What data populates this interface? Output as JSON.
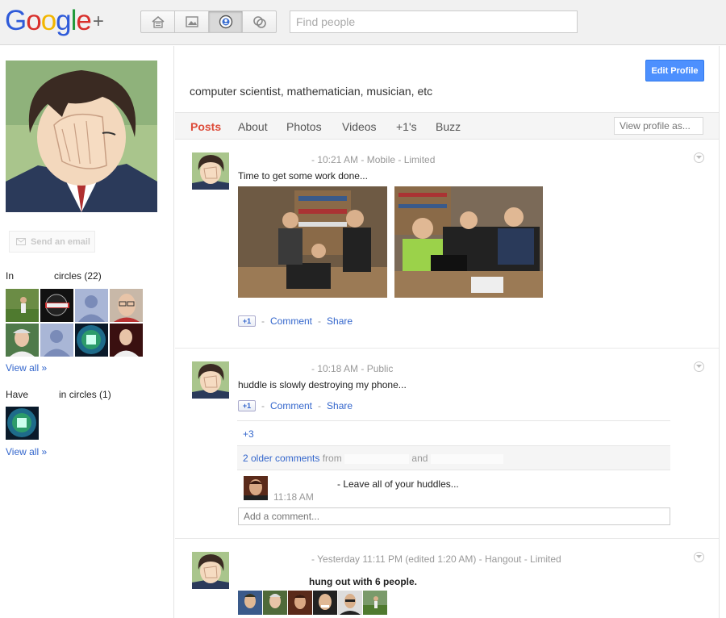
{
  "header": {
    "logo_parts": [
      "G",
      "o",
      "o",
      "g",
      "l",
      "e"
    ],
    "logo_plus": "+",
    "search_placeholder": "Find people",
    "nav_icons": [
      "home-icon",
      "photos-icon",
      "profile-icon",
      "circles-icon"
    ]
  },
  "profile": {
    "email_label": "Send an email",
    "in_circles_label": "In",
    "in_circles_count": "circles (22)",
    "have_label": "Have",
    "have_count": "in circles (1)",
    "view_all_1": "View all »",
    "view_all_2": "View all »",
    "edit_label": "Edit Profile",
    "tagline": "computer scientist, mathematician, musician, etc"
  },
  "tabs": [
    "Posts",
    "About",
    "Photos",
    "Videos",
    "+1's",
    "Buzz"
  ],
  "view_as_placeholder": "View profile as...",
  "posts": [
    {
      "meta": "-  10:21 AM  -  Mobile  -  Limited",
      "text": "Time to get some work done...",
      "comment": "Comment",
      "share": "Share",
      "plusone": "+1"
    },
    {
      "meta": "-  10:18 AM  -  Public",
      "text": "huddle is slowly destroying my phone...",
      "comment": "Comment",
      "share": "Share",
      "plusone": "+1",
      "plus_count": "+3",
      "older_comments": "2 older comments",
      "from_label": "from",
      "and_label": "and",
      "comment_text": "- Leave all of your huddles...",
      "comment_time": "11:18 AM",
      "add_comment_placeholder": "Add a comment..."
    },
    {
      "meta": "-  Yesterday 11:11 PM (edited 1:20 AM)  -  Hangout  -  Limited",
      "text": "hung out with 6 people."
    }
  ],
  "colors": {
    "accent_red": "#dd4b39",
    "link_blue": "#3366cc",
    "button_blue": "#4d90fe"
  }
}
